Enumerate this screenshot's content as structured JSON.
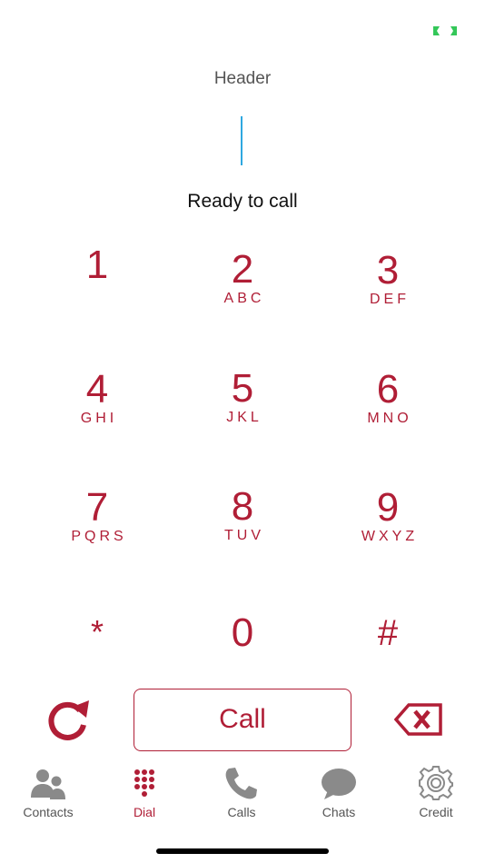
{
  "header": {
    "title": "Header"
  },
  "status": {
    "text": "Ready to call"
  },
  "keypad": {
    "keys": [
      {
        "digit": "1",
        "letters": ""
      },
      {
        "digit": "2",
        "letters": "ABC"
      },
      {
        "digit": "3",
        "letters": "DEF"
      },
      {
        "digit": "4",
        "letters": "GHI"
      },
      {
        "digit": "5",
        "letters": "JKL"
      },
      {
        "digit": "6",
        "letters": "MNO"
      },
      {
        "digit": "7",
        "letters": "PQRS"
      },
      {
        "digit": "8",
        "letters": "TUV"
      },
      {
        "digit": "9",
        "letters": "WXYZ"
      },
      {
        "digit": "*",
        "letters": ""
      },
      {
        "digit": "0",
        "letters": ""
      },
      {
        "digit": "#",
        "letters": ""
      }
    ]
  },
  "controls": {
    "call_label": "Call",
    "redial_icon": "redial-icon",
    "backspace_icon": "backspace-icon"
  },
  "tabbar": {
    "tabs": [
      {
        "label": "Contacts",
        "icon": "contacts-icon"
      },
      {
        "label": "Dial",
        "icon": "dialpad-icon",
        "active": true
      },
      {
        "label": "Calls",
        "icon": "phone-icon"
      },
      {
        "label": "Chats",
        "icon": "chat-bubble-icon"
      },
      {
        "label": "Credit",
        "icon": "gear-icon"
      }
    ]
  },
  "colors": {
    "accent": "#b01e36",
    "caret": "#2fa8e0",
    "inactive": "#8a8a8a",
    "status_icon": "#34c759"
  }
}
